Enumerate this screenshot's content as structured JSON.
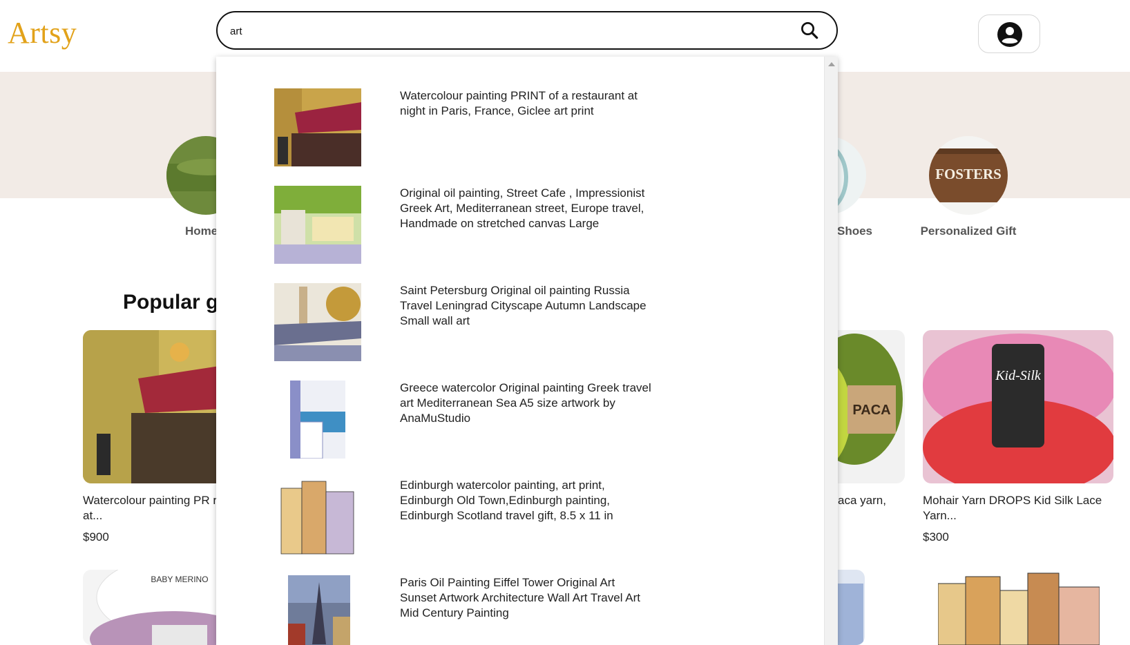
{
  "header": {
    "logo": "Artsy",
    "search": {
      "value": "art",
      "placeholder": ""
    }
  },
  "categories": [
    {
      "label": "Home"
    },
    {
      "label": "Shoes"
    },
    {
      "label": "Personalized Gift"
    }
  ],
  "section": {
    "title": "Popular g"
  },
  "products": [
    {
      "title": "Watercolour painting PR restaurant at...",
      "price": "$900"
    },
    {
      "title": "aca yarn,",
      "price": ""
    },
    {
      "title": "Mohair Yarn DROPS Kid Silk Lace Yarn...",
      "price": "$300"
    }
  ],
  "bottom_cards": [
    {
      "image_text": "BABY MERINO"
    },
    {
      "image_text": ""
    },
    {
      "image_text": ""
    }
  ],
  "personalized_gift_image_text": "FOSTERS",
  "mohair_image_text": "Kid-Silk",
  "dropdown": {
    "results": [
      {
        "line1": "Watercolour painting PRINT of a restaurant at",
        "line2": "night in Paris, France, Giclee art print",
        "line3": ""
      },
      {
        "line1": "Original oil painting, Street Cafe , Impressionist",
        "line2": "Greek Art, Mediterranean street, Europe travel,",
        "line3": "Handmade on stretched canvas Large"
      },
      {
        "line1": "Saint Petersburg Original oil painting Russia",
        "line2": "Travel Leningrad Cityscape Autumn Landscape",
        "line3": "Small wall art"
      },
      {
        "line1": "Greece watercolor Original painting Greek travel",
        "line2": "art Mediterranean Sea A5 size artwork by",
        "line3": "AnaMuStudio"
      },
      {
        "line1": "Edinburgh watercolor painting, art print,",
        "line2": "Edinburgh Old Town,Edinburgh painting,",
        "line3": "Edinburgh Scotland travel gift, 8.5 x 11 in"
      },
      {
        "line1": "Paris Oil Painting Eiffel Tower Original Art",
        "line2": "Sunset Artwork Architecture Wall Art Travel Art",
        "line3": "Mid Century Painting"
      }
    ]
  },
  "colors": {
    "logo": "#e2a21a",
    "hero_band": "#f2ebe6"
  },
  "icons": {
    "search": "search-icon",
    "account": "account-circle-icon"
  }
}
